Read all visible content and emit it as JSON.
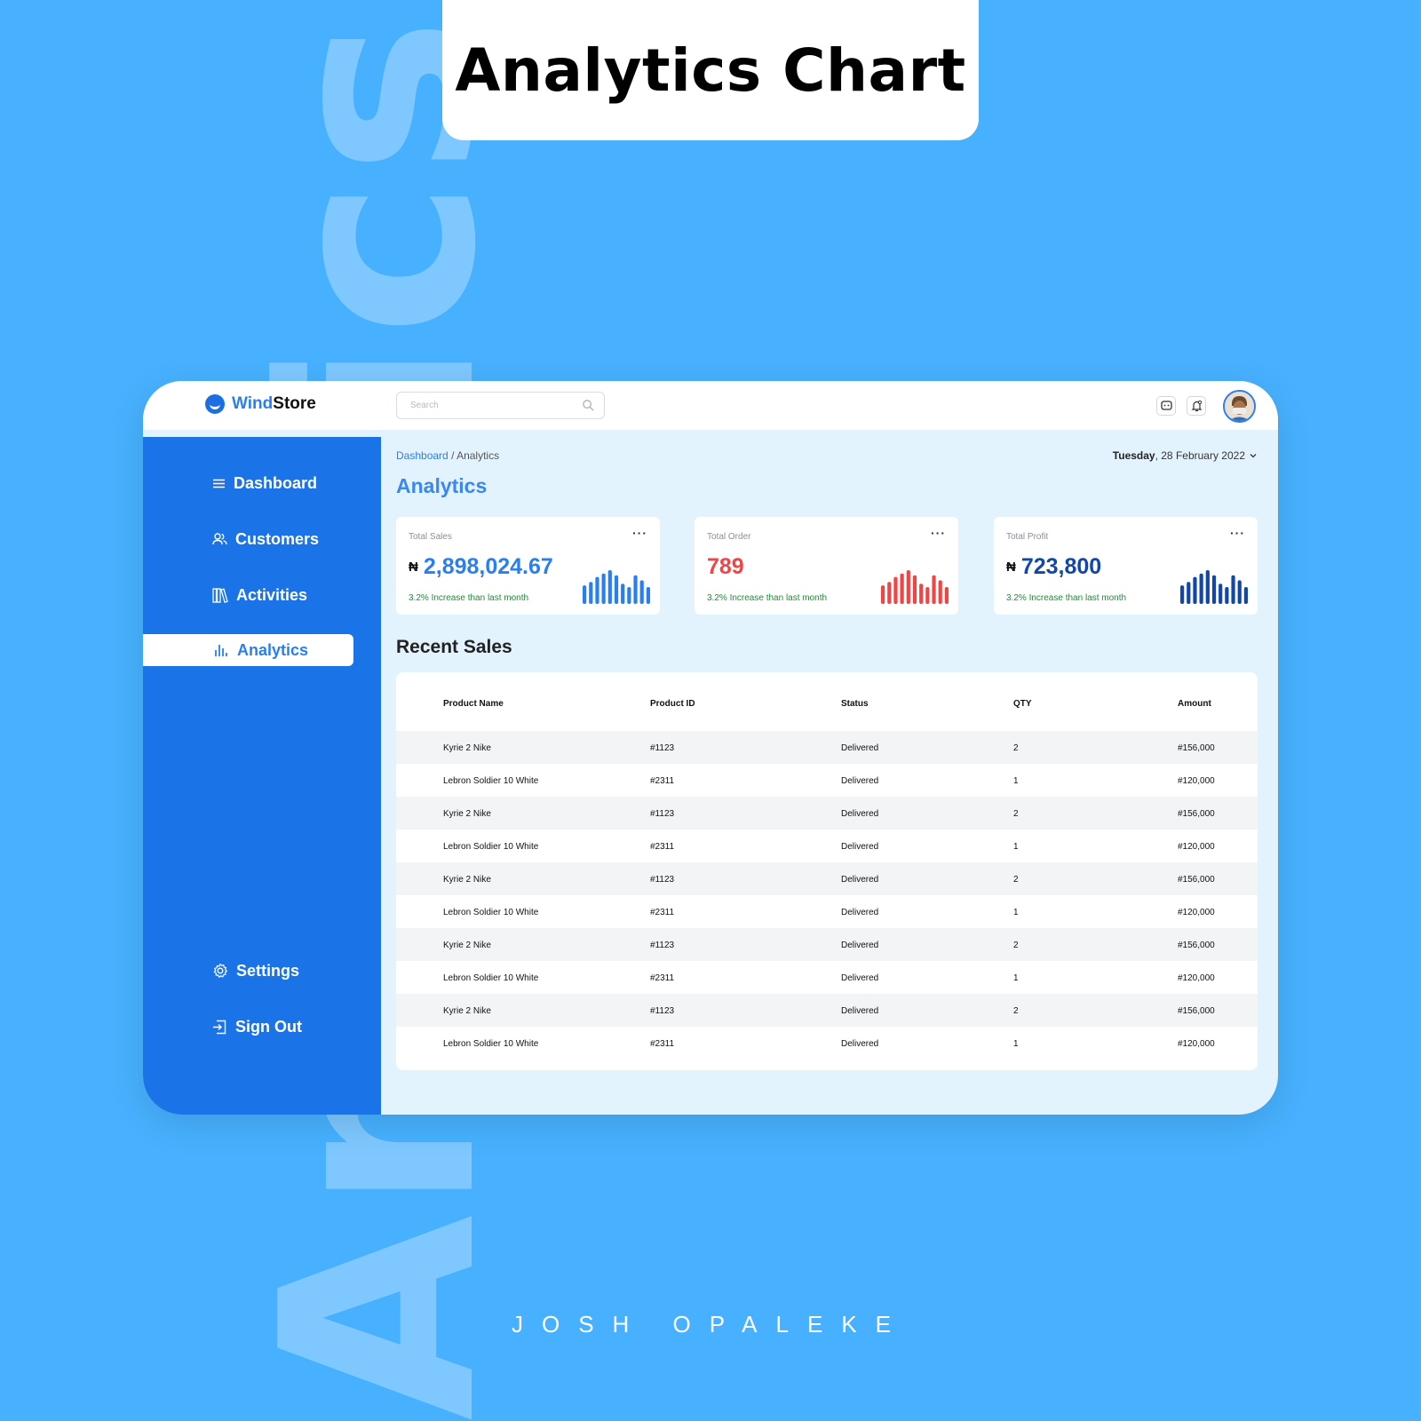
{
  "background_word": "Analytics",
  "header_title": "Analytics Chart",
  "signature": "JOSH OPALEKE",
  "colors": {
    "background": "#47b1ff",
    "sidebar": "#1b73e8",
    "accent": "#2a7fef",
    "sales": "#2a7fef",
    "order": "#f04545",
    "profit": "#1247a8",
    "positive": "#1e8c3a"
  },
  "app": {
    "brand": {
      "prefix": "Wind",
      "suffix": "Store"
    },
    "search": {
      "placeholder": "Search",
      "icon": "search-icon"
    },
    "sidebar": {
      "items": [
        {
          "label": "Dashboard",
          "icon": "menu-icon"
        },
        {
          "label": "Customers",
          "icon": "users-icon"
        },
        {
          "label": "Activities",
          "icon": "books-icon"
        },
        {
          "label": "Analytics",
          "icon": "bar-chart-icon",
          "active": true
        }
      ],
      "bottom": [
        {
          "label": "Settings",
          "icon": "gear-icon"
        },
        {
          "label": "Sign Out",
          "icon": "sign-out-icon"
        }
      ]
    },
    "breadcrumb": {
      "root": "Dashboard",
      "current": "/ Analytics"
    },
    "date": {
      "day": "Tuesday",
      "rest": ", 28 February 2022"
    },
    "page_title": "Analytics",
    "stats": [
      {
        "label": "Total Sales",
        "currency": "₦",
        "value": "2,898,024.67",
        "note": "3.2% Increase than last month",
        "menu": "···"
      },
      {
        "label": "Total Order",
        "currency": "",
        "value": "789",
        "note": "3.2% Increase than last month",
        "menu": "···"
      },
      {
        "label": "Total Profit",
        "currency": "₦",
        "value": "723,800",
        "note": "3.2% Increase than last month",
        "menu": "···"
      }
    ],
    "section_title": "Recent  Sales",
    "table": {
      "headers": [
        "Product Name",
        "Product ID",
        "Status",
        "QTY",
        "Amount"
      ],
      "rows": [
        [
          "Kyrie 2 Nike",
          "#1123",
          "Delivered",
          "2",
          "#156,000"
        ],
        [
          "Lebron Soldier 10 White",
          "#2311",
          "Delivered",
          "1",
          "#120,000"
        ],
        [
          "Kyrie 2 Nike",
          "#1123",
          "Delivered",
          "2",
          "#156,000"
        ],
        [
          "Lebron Soldier 10 White",
          "#2311",
          "Delivered",
          "1",
          "#120,000"
        ],
        [
          "Kyrie 2 Nike",
          "#1123",
          "Delivered",
          "2",
          "#156,000"
        ],
        [
          "Lebron Soldier 10 White",
          "#2311",
          "Delivered",
          "1",
          "#120,000"
        ],
        [
          "Kyrie 2 Nike",
          "#1123",
          "Delivered",
          "2",
          "#156,000"
        ],
        [
          "Lebron Soldier 10 White",
          "#2311",
          "Delivered",
          "1",
          "#120,000"
        ],
        [
          "Kyrie 2 Nike",
          "#1123",
          "Delivered",
          "2",
          "#156,000"
        ],
        [
          "Lebron Soldier 10 White",
          "#2311",
          "Delivered",
          "1",
          "#120,000"
        ]
      ]
    }
  },
  "chart_data": [
    {
      "type": "bar",
      "name": "total-sales-sparkline",
      "values": [
        0.55,
        0.65,
        0.8,
        0.9,
        1.0,
        0.85,
        0.6,
        0.5,
        0.85,
        0.7,
        0.5
      ]
    },
    {
      "type": "bar",
      "name": "total-order-sparkline",
      "values": [
        0.55,
        0.65,
        0.8,
        0.9,
        1.0,
        0.85,
        0.6,
        0.5,
        0.85,
        0.7,
        0.5
      ]
    },
    {
      "type": "bar",
      "name": "total-profit-sparkline",
      "values": [
        0.55,
        0.65,
        0.8,
        0.9,
        1.0,
        0.85,
        0.6,
        0.5,
        0.85,
        0.7,
        0.5
      ]
    }
  ]
}
